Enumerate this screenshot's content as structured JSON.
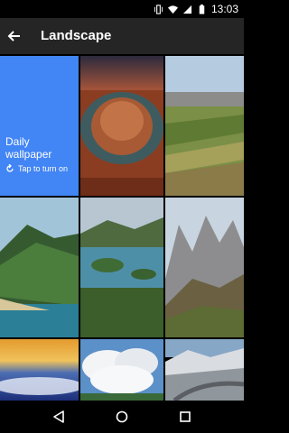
{
  "status_bar": {
    "time": "13:03",
    "icons": [
      "vibrate-icon",
      "wifi-icon",
      "signal-icon",
      "battery-icon"
    ]
  },
  "app_bar": {
    "title": "Landscape",
    "back_icon": "arrow-back-icon"
  },
  "daily_tile": {
    "title": "Daily wallpaper",
    "action_label": "Tap to turn on",
    "action_icon": "refresh-icon",
    "color": "#4285F4"
  },
  "wallpapers": [
    {
      "subject": "canyon horseshoe bend"
    },
    {
      "subject": "green terraced fields"
    },
    {
      "subject": "tropical coastline"
    },
    {
      "subject": "bay with green hills"
    },
    {
      "subject": "rocky mountain peaks"
    },
    {
      "subject": "sunset cloud sea"
    },
    {
      "subject": "blue sky clouds"
    },
    {
      "subject": "snowy mountain highway"
    }
  ],
  "nav_bar": {
    "icons": [
      "back-triangle-icon",
      "home-circle-icon",
      "recents-square-icon"
    ]
  }
}
